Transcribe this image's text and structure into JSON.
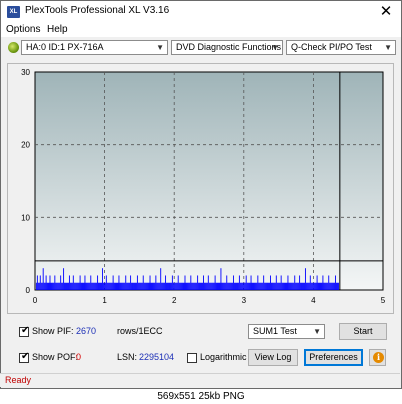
{
  "window": {
    "title": "PlexTools Professional XL V3.16",
    "app_icon": "XL",
    "close_glyph": "✕"
  },
  "menu": {
    "items": [
      "Options",
      "Help"
    ]
  },
  "toolbar": {
    "drive": "HA:0 ID:1  PX-716A",
    "function": "DVD Diagnostic Functions",
    "test": "Q-Check PI/PO Test"
  },
  "chart_data": {
    "type": "bar",
    "y_ticks": [
      "30",
      "20",
      "10",
      "0"
    ],
    "x_ticks": [
      "0",
      "1",
      "2",
      "3",
      "4",
      "5"
    ],
    "xlim": [
      0,
      5
    ],
    "ylim": [
      0,
      30
    ],
    "end_marker_x": 4.38,
    "threshold_y": 4,
    "grid": true,
    "colors": {
      "bars": "#0000ff",
      "plot_top": "#9fb4b8",
      "plot_bottom": "#f4f6f6"
    },
    "values": [
      1,
      2,
      1,
      1,
      2,
      1,
      1,
      3,
      1,
      1,
      2,
      1,
      1,
      1,
      2,
      1,
      1,
      1,
      1,
      2,
      1,
      1,
      1,
      1,
      1,
      2,
      1,
      1,
      3,
      1,
      1,
      1,
      1,
      1,
      2,
      1,
      1,
      1,
      2,
      1,
      1,
      1,
      1,
      1,
      1,
      2,
      1,
      1,
      1,
      1,
      2,
      1,
      1,
      1,
      1,
      1,
      2,
      1,
      1,
      1,
      1,
      1,
      1,
      2,
      1,
      1,
      1,
      1,
      3,
      1,
      1,
      1,
      2,
      1,
      1,
      1,
      1,
      1,
      1,
      2,
      1,
      1,
      1,
      1,
      1,
      2,
      1,
      1,
      1,
      1,
      1,
      1,
      2,
      1,
      1,
      1,
      1,
      2,
      1,
      1,
      1,
      1,
      1,
      1,
      2,
      1,
      1,
      1,
      1,
      1,
      2,
      1,
      1,
      1,
      1,
      1,
      1,
      2,
      1,
      1,
      1,
      1,
      1,
      2,
      1,
      1,
      1,
      1,
      3,
      1,
      1,
      1,
      1,
      2,
      1,
      1,
      1,
      1,
      1,
      1,
      2,
      1,
      1,
      1,
      1,
      1,
      2,
      1,
      1,
      1,
      1,
      1,
      1,
      2,
      1,
      1,
      1,
      1,
      1,
      2,
      1,
      1,
      1,
      1,
      1,
      1,
      2,
      1,
      1,
      1,
      1,
      1,
      2,
      1,
      1,
      1,
      1,
      2,
      1,
      1,
      1,
      1,
      1,
      1,
      2,
      1,
      1,
      1,
      1,
      1,
      3,
      1,
      1,
      1,
      1,
      1,
      2,
      1,
      1,
      1,
      1,
      1,
      1,
      2,
      1,
      1,
      1,
      1,
      1,
      2,
      1,
      1,
      1,
      1,
      1,
      1,
      2,
      1,
      1,
      1,
      1,
      2,
      1,
      1,
      1,
      1,
      1,
      1,
      2,
      1,
      1,
      1,
      1,
      1,
      2,
      1,
      1,
      1,
      1,
      1,
      1,
      2,
      1,
      1,
      1,
      1,
      1,
      2,
      1,
      1,
      1,
      1,
      2,
      1,
      1,
      1,
      1,
      1,
      1,
      2,
      1,
      1,
      1,
      1,
      1,
      1,
      2,
      1,
      1,
      1,
      1,
      2,
      1,
      1,
      1,
      1,
      1,
      3,
      1,
      1,
      1,
      1,
      2,
      1,
      1,
      1,
      1,
      1,
      1,
      2,
      1,
      1,
      1,
      1,
      1,
      2,
      1,
      1,
      1,
      1,
      1,
      2,
      1,
      1,
      1,
      1,
      1,
      1,
      2,
      1,
      1,
      1
    ]
  },
  "controls": {
    "show_pif": {
      "label": "Show PIF:",
      "value": "2670",
      "unit": "rows/1ECC",
      "checked": true
    },
    "show_pof": {
      "label": "Show POF:",
      "value": "0",
      "checked": true
    },
    "lsn": {
      "label": "LSN:",
      "value": "2295104"
    },
    "logarithmic": {
      "label": "Logarithmic",
      "checked": false
    },
    "mode_select": "SUM1 Test",
    "start_label": "Start",
    "view_log_label": "View Log",
    "preferences_label": "Preferences",
    "info_glyph": "i",
    "checkmark": "✔"
  },
  "status": {
    "text": "Ready"
  },
  "caption": {
    "text": "569x551  25kb  PNG"
  }
}
